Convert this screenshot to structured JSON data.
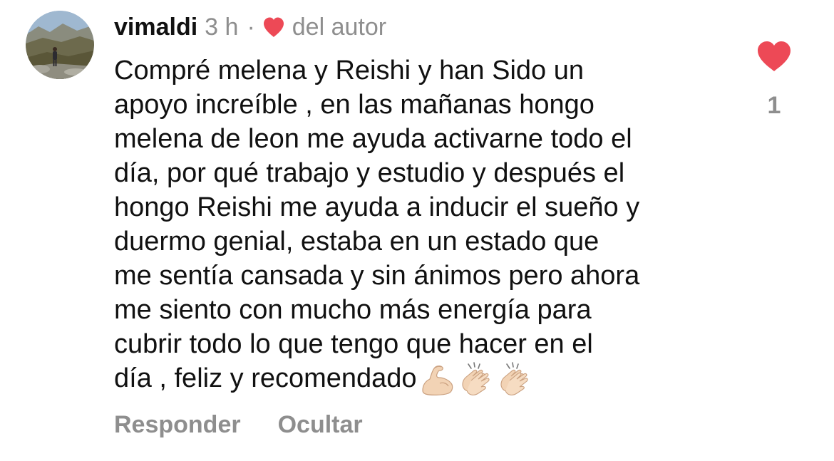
{
  "comment": {
    "username": "vimaldi",
    "time": "3 h",
    "separator": "·",
    "author_badge": "del autor",
    "text_lines": [
      "Compré melena y Reishi y han Sido un",
      "apoyo increíble , en las mañanas  hongo",
      "melena de leon me ayuda activarne todo el",
      "día, por qué trabajo y estudio y después el",
      "hongo Reishi me ayuda a inducir el sueño y",
      "duermo genial, estaba en un estado que",
      "me sentía cansada y sin ánimos pero ahora",
      "me siento con mucho más energía para",
      "cubrir todo lo que tengo que hacer en el",
      "día , feliz y recomendado"
    ],
    "emojis": [
      "flexed-biceps-icon",
      "clapping-hands-icon",
      "clapping-hands-icon"
    ],
    "like_count": "1",
    "liked": true
  },
  "actions": {
    "reply": "Responder",
    "hide": "Ocultar"
  },
  "colors": {
    "heart": "#ed4956",
    "secondary_text": "#8e8e8e",
    "primary_text": "#111111"
  },
  "icons": {
    "author_heart": "heart-filled-icon",
    "like_heart": "heart-filled-icon"
  }
}
